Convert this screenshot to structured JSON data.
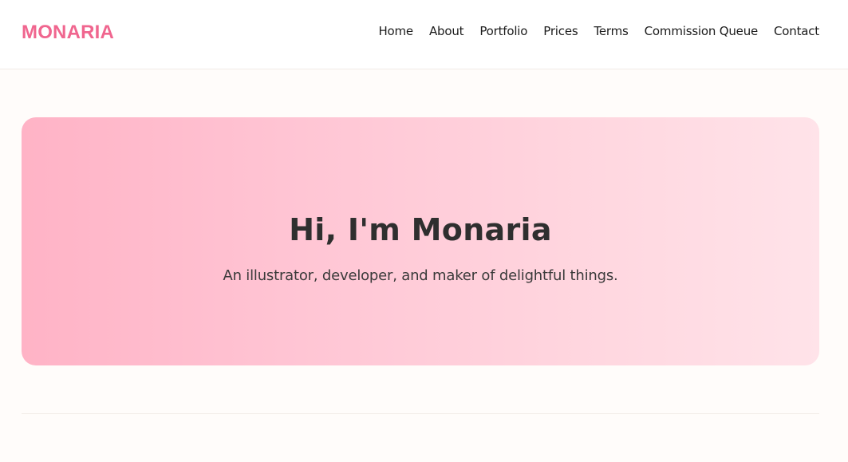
{
  "header": {
    "brand": "MONARIA",
    "nav": [
      "Home",
      "About",
      "Portfolio",
      "Prices",
      "Terms",
      "Commission Queue",
      "Contact"
    ]
  },
  "hero": {
    "title": "Hi, I'm Monaria",
    "subtitle": "An illustrator, developer, and maker of delightful things."
  },
  "colors": {
    "brand": "#f0668f",
    "hero_gradient_start": "#ffb3c6",
    "hero_gradient_end": "#ffe3e9",
    "page_background": "#fffcfa"
  }
}
